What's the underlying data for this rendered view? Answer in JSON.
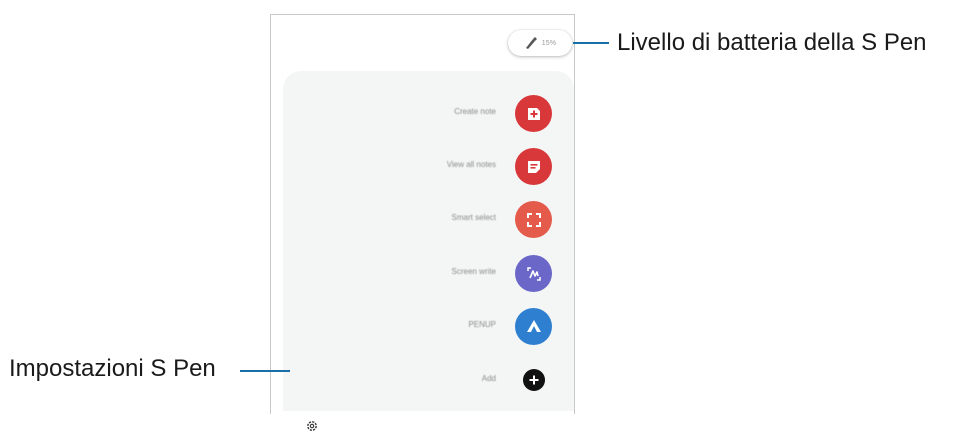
{
  "callouts": {
    "battery": "Livello di batteria della S Pen",
    "settings": "Impostazioni S Pen"
  },
  "status": {
    "battery_pct": "15%"
  },
  "commands": [
    {
      "label": "Create note",
      "icon": "create-note-icon",
      "color": "#d8383a"
    },
    {
      "label": "View all notes",
      "icon": "view-all-notes-icon",
      "color": "#d8383a"
    },
    {
      "label": "Smart select",
      "icon": "smart-select-icon",
      "color": "#e45a4b"
    },
    {
      "label": "Screen write",
      "icon": "screen-write-icon",
      "color": "#6a67c8"
    },
    {
      "label": "PENUP",
      "icon": "penup-icon",
      "color": "#2f7fd1"
    },
    {
      "label": "Add",
      "icon": "add-icon",
      "color": "#111111"
    }
  ],
  "colors": {
    "accent_line": "#1a6fa8",
    "panel_bg": "#f4f6f6"
  }
}
